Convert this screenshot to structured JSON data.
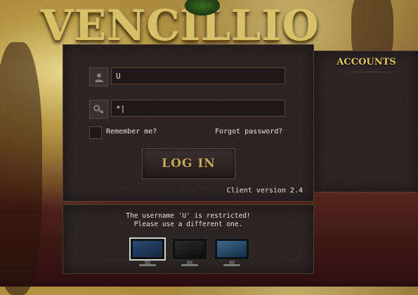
{
  "app": {
    "logo_text": "VENCILLIO"
  },
  "login": {
    "username_value": "U",
    "password_value": "*|",
    "remember_label": "Remember me?",
    "forgot_label": "Forgot password?",
    "login_button": "LOG IN",
    "client_version": "Client version 2.4"
  },
  "accounts": {
    "title": "ACCOUNTS"
  },
  "status": {
    "line1": "The username 'U' is restricted!",
    "line2": "Please use a different one."
  },
  "display_modes": [
    {
      "name": "monitor-mode-1",
      "selected": true
    },
    {
      "name": "monitor-mode-2",
      "selected": false
    },
    {
      "name": "monitor-mode-3",
      "selected": false
    }
  ],
  "icons": [
    "user-icon",
    "key-icon",
    "monitor-icon"
  ],
  "colors": {
    "gold": "#d8c069",
    "panel": "#2c2424",
    "text": "#e8e2d6"
  }
}
